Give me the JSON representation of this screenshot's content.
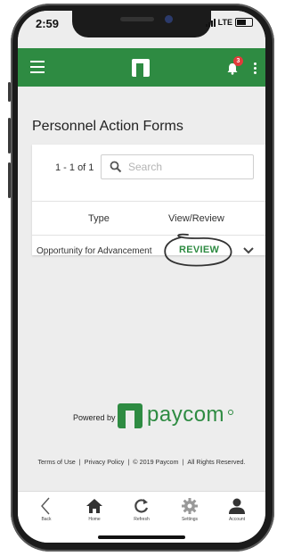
{
  "status_bar": {
    "time": "2:59",
    "network": "LTE"
  },
  "app_bar": {
    "notification_count": "3",
    "colors": {
      "brand_green": "#2e8b42"
    }
  },
  "page": {
    "title": "Personnel Action Forms"
  },
  "table": {
    "count_text": "1 - 1 of 1",
    "search_placeholder": "Search",
    "headers": {
      "type": "Type",
      "view": "View/Review"
    },
    "rows": [
      {
        "type": "Opportunity for Advancement",
        "action": "REVIEW"
      }
    ]
  },
  "branding": {
    "powered_by": "Powered by",
    "wordmark": "paycom"
  },
  "footer": {
    "terms": "Terms of Use",
    "separator": "|",
    "privacy": "Privacy Policy",
    "copyright": "© 2019 Paycom",
    "rights": "All Rights Reserved."
  },
  "tabs": [
    {
      "label": "Back",
      "icon": "back-chevron-icon"
    },
    {
      "label": "Home",
      "icon": "home-icon"
    },
    {
      "label": "Refresh",
      "icon": "refresh-icon"
    },
    {
      "label": "Settings",
      "icon": "gear-icon"
    },
    {
      "label": "Account",
      "icon": "person-icon"
    }
  ]
}
